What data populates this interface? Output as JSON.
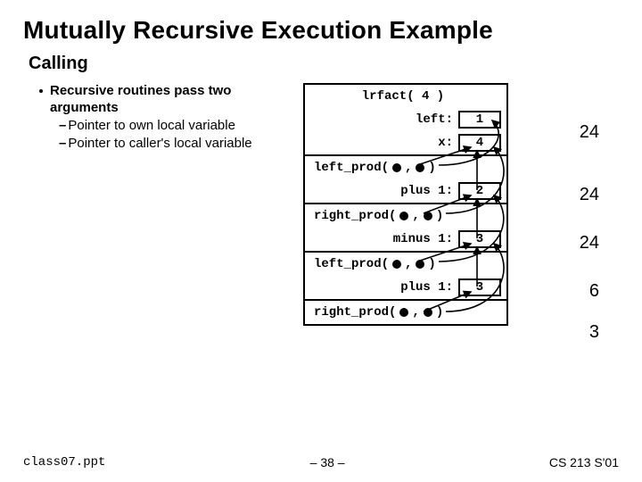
{
  "title": "Mutually Recursive Execution Example",
  "subhead": "Calling",
  "bullet": "Recursive routines pass two arguments",
  "sub1": "Pointer to own local variable",
  "sub2": "Pointer to caller's local variable",
  "stack": {
    "call0": "lrfact( 4 )",
    "left_lab": "left:",
    "left_val": "1",
    "x_lab": "x:",
    "x_val": "4",
    "lp1": "left_prod(",
    "plus1_lab": "plus 1:",
    "plus1_val": "2",
    "rp1": "right_prod(",
    "minus1_lab": "minus 1:",
    "minus1_val": "3",
    "lp2": "left_prod(",
    "plus2_lab": "plus 1:",
    "plus2_val": "3",
    "rp2": "right_prod(",
    "comma": ",",
    "close": ")"
  },
  "results": {
    "r1": "24",
    "r2": "24",
    "r3": "24",
    "r4": "6",
    "r5": "3"
  },
  "footer": {
    "file": "class07.ppt",
    "page": "– 38 –",
    "course": "CS 213 S'01"
  }
}
